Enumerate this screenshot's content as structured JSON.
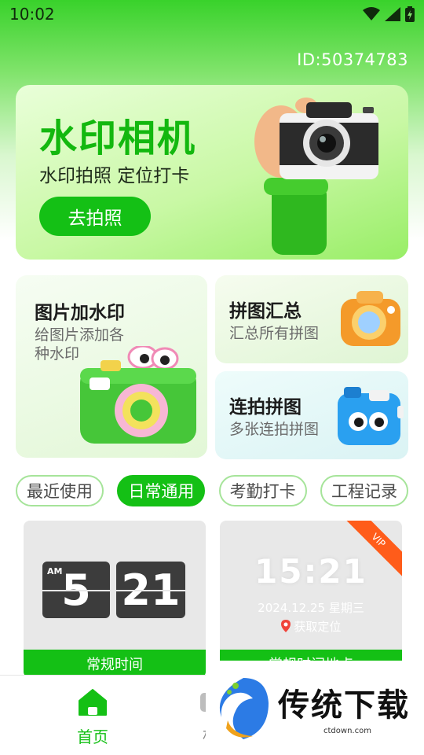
{
  "status_bar": {
    "time": "10:02"
  },
  "header": {
    "user_id": "ID:50374783"
  },
  "hero": {
    "title": "水印相机",
    "subtitle": "水印拍照 定位打卡",
    "button_label": "去拍照"
  },
  "features": {
    "watermark": {
      "title": "图片加水印",
      "desc": "给图片添加各种水印"
    },
    "collage_summary": {
      "title": "拼图汇总",
      "desc": "汇总所有拼图"
    },
    "burst_collage": {
      "title": "连拍拼图",
      "desc": "多张连拍拼图"
    }
  },
  "tabs": [
    {
      "label": "最近使用",
      "active": false
    },
    {
      "label": "日常通用",
      "active": true
    },
    {
      "label": "考勤打卡",
      "active": false
    },
    {
      "label": "工程记录",
      "active": false
    }
  ],
  "templates": {
    "left": {
      "am": "AM",
      "hour": "5",
      "minute": "21",
      "label": "常规时间"
    },
    "right": {
      "time": "15:21",
      "date": "2024.12.25 星期三",
      "location": "获取定位",
      "badge": "VIP",
      "label": "常规时间地点"
    }
  },
  "bottom_nav": {
    "home_label": "首页",
    "second_label": "相"
  },
  "watermark_overlay": {
    "brand": "传统下载",
    "url": "ctdown.com"
  },
  "colors": {
    "brand_green": "#14c015",
    "vip_orange": "#ff5c1a"
  }
}
